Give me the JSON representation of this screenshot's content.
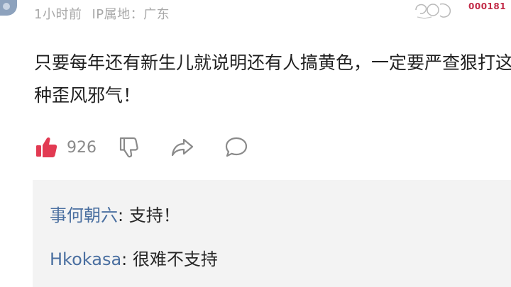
{
  "comment": {
    "time": "1小时前",
    "ip_location": "IP属地：广东",
    "text": "只要每年还有新生儿就说明还有人搞黄色，一定要严查狠打这种歪风邪气！",
    "like_count": "926"
  },
  "badge": {
    "code": "000181"
  },
  "replies": [
    {
      "user": "事何朝六",
      "text": "支持！"
    },
    {
      "user": "Hkokasa",
      "text": "很难不支持"
    }
  ],
  "colors": {
    "like_red": "#e23a52",
    "reply_user": "#4a6fa0",
    "meta_gray": "#a8a8a8",
    "reply_bg": "#f3f3f3"
  },
  "icons": {
    "like": "thumbs-up-icon",
    "dislike": "thumbs-down-icon",
    "share": "share-arrow-icon",
    "comment": "comment-bubble-icon"
  }
}
